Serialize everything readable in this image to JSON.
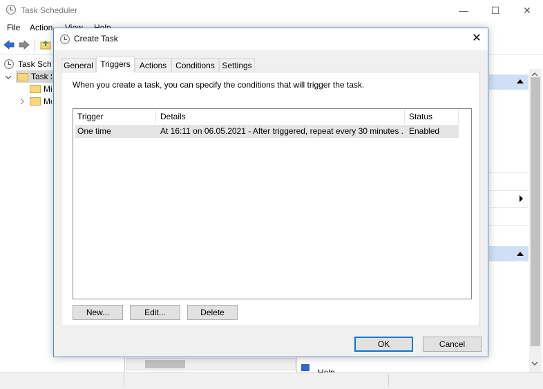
{
  "main": {
    "title": "Task Scheduler",
    "menu": [
      "File",
      "Action",
      "View",
      "Help"
    ],
    "tree": {
      "root": "Task Scheduler (Local)",
      "library": "Task Scheduler Library",
      "child1": "Microsoft",
      "child2": "Mozilla"
    },
    "right_bottom_label": "Help"
  },
  "dialog": {
    "title": "Create Task",
    "close_glyph": "✕",
    "tabs": [
      "General",
      "Triggers",
      "Actions",
      "Conditions",
      "Settings"
    ],
    "active_tab": "Triggers",
    "description": "When you create a task, you can specify the conditions that will trigger the task.",
    "columns": [
      "Trigger",
      "Details",
      "Status"
    ],
    "rows": [
      {
        "trigger": "One time",
        "details": "At 16:11 on 06.05.2021 - After triggered, repeat every 30 minutes ...",
        "status": "Enabled"
      }
    ],
    "buttons": {
      "new": "New...",
      "edit": "Edit...",
      "delete": "Delete"
    },
    "ok": "OK",
    "cancel": "Cancel"
  },
  "colors": {
    "accent": "#0078d7",
    "row_selected": "#e5e5e5",
    "dialog_bg": "#f0f0f0"
  },
  "icons": {
    "app": "clock-icon",
    "back": "arrow-left-icon",
    "forward": "arrow-right-icon",
    "folder": "folder-icon"
  }
}
